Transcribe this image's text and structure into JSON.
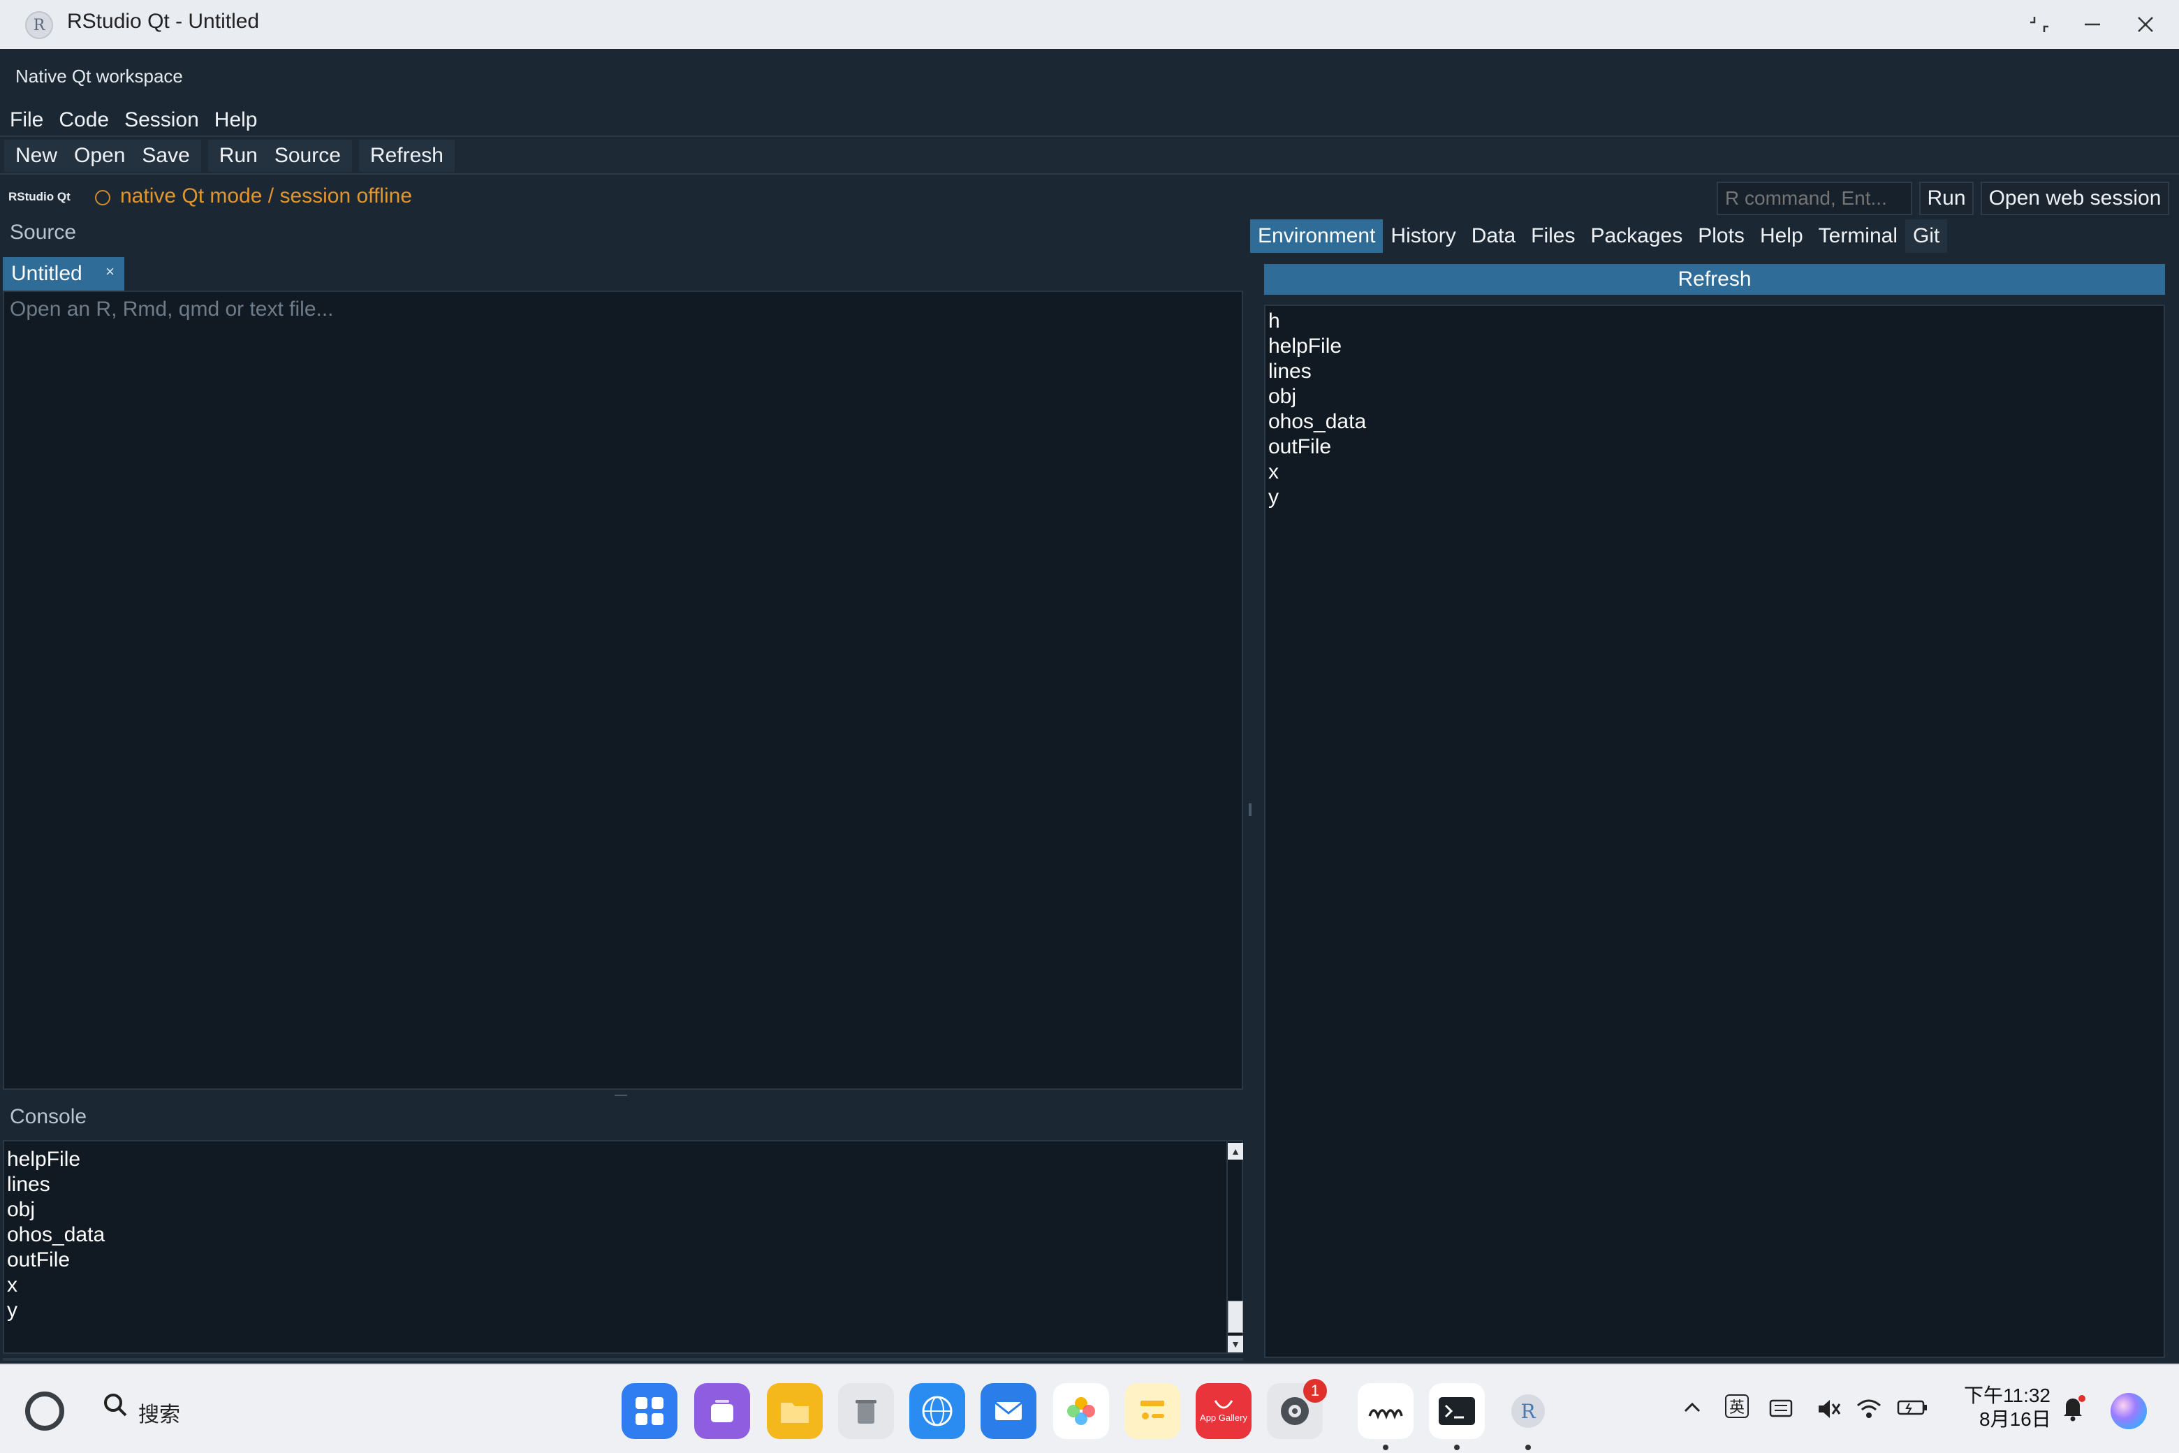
{
  "window": {
    "title": "RStudio Qt - Untitled",
    "controls": [
      "restore",
      "minimize",
      "close"
    ]
  },
  "workspace_label": "Native Qt workspace",
  "menu": [
    "File",
    "Code",
    "Session",
    "Help"
  ],
  "toolbar": {
    "groups": [
      [
        "New",
        "Open",
        "Save"
      ],
      [
        "Run",
        "Source"
      ],
      [
        "Refresh"
      ]
    ]
  },
  "status": {
    "brand": "RStudio Qt",
    "text": "native Qt mode / session offline",
    "command_placeholder": "R command, Ent...",
    "run_label": "Run",
    "open_web_label": "Open web session"
  },
  "source": {
    "title": "Source",
    "tab_label": "Untitled",
    "tab_close": "×",
    "placeholder": "Open an R, Rmd, qmd or text file..."
  },
  "console": {
    "title": "Console",
    "lines": [
      "helpFile",
      "lines",
      "obj",
      "ohos_data",
      "outFile",
      "x",
      "y"
    ]
  },
  "right_tabs": {
    "items": [
      "Environment",
      "History",
      "Data",
      "Files",
      "Packages",
      "Plots",
      "Help",
      "Terminal",
      "Git"
    ],
    "active": "Environment"
  },
  "environment": {
    "refresh_label": "Refresh",
    "items": [
      "h",
      "helpFile",
      "lines",
      "obj",
      "ohos_data",
      "outFile",
      "x",
      "y"
    ]
  },
  "taskbar": {
    "search_label": "搜索",
    "apps": [
      "launcher",
      "multi-window",
      "file-manager",
      "trash",
      "browser",
      "mail",
      "photos",
      "notes",
      "app-gallery",
      "settings",
      "mem-monitor",
      "terminal",
      "rstudio"
    ],
    "app_gallery_label": "App Gallery",
    "settings_badge": "1",
    "ime_label": "英",
    "time": "下午11:32",
    "date": "8月16日"
  },
  "colors": {
    "accent": "#2f6d98",
    "status_orange": "#e0952f",
    "background": "#1b2733",
    "panel": "#111a23"
  }
}
